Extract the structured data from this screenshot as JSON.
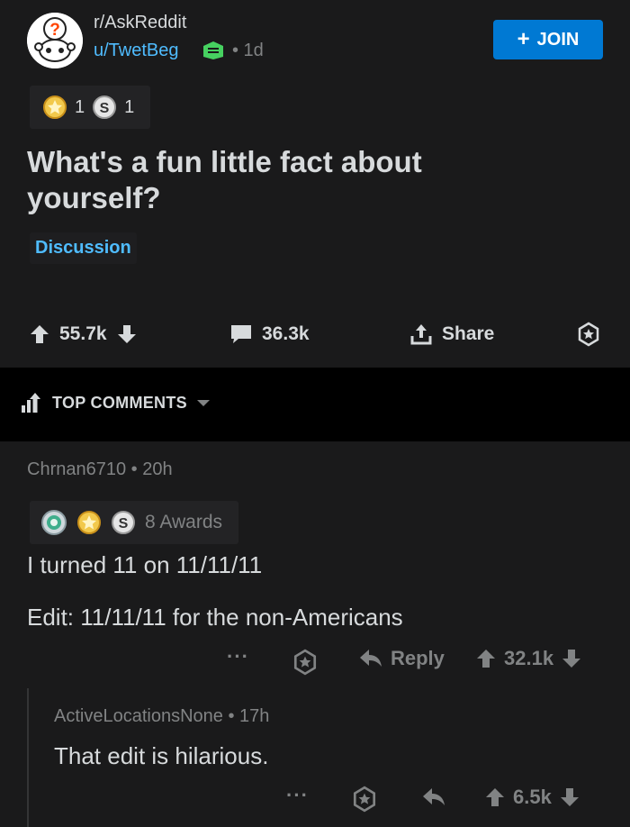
{
  "post": {
    "subreddit": "r/AskReddit",
    "username": "u/TwetBeg",
    "age": "• 1d",
    "join_label": "JOIN",
    "awards": [
      {
        "icon": "gold-award-icon",
        "count": "1"
      },
      {
        "icon": "silver-award-icon",
        "count": "1"
      }
    ],
    "title": "What's a fun little fact about yourself?",
    "flair": "Discussion",
    "upvotes": "55.7k",
    "comments": "36.3k",
    "share_label": "Share"
  },
  "sort": {
    "label": "TOP COMMENTS"
  },
  "comment": {
    "author": "Chrnan6710",
    "age": "• 20h",
    "awards_label": "8 Awards",
    "line1": "I turned 11 on 11/11/11",
    "line2": "Edit: 11/11/11 for the non-Americans",
    "more": "···",
    "reply_label": "Reply",
    "score": "32.1k"
  },
  "reply": {
    "author": "ActiveLocationsNone",
    "age": "• 17h",
    "text": "That edit is hilarious.",
    "more": "···",
    "score": "6.5k"
  },
  "colors": {
    "accent": "#0079d3",
    "link": "#4fbcff",
    "background": "#1a1a1b",
    "muted": "#818384"
  }
}
